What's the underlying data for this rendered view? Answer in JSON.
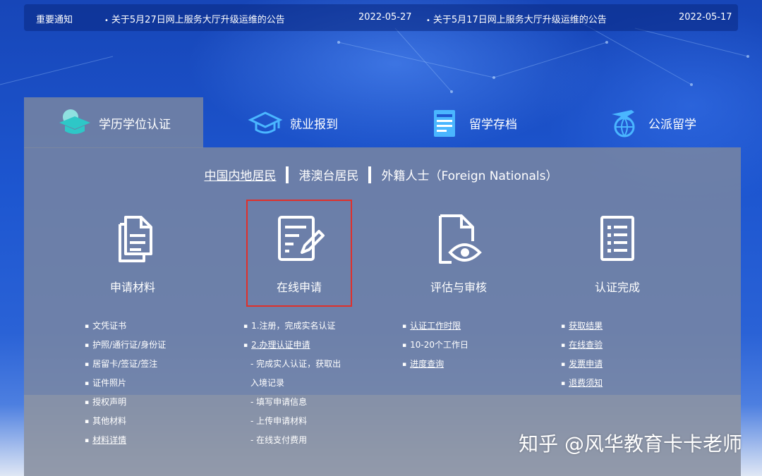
{
  "notice": {
    "label": "重要通知",
    "items": [
      {
        "text": "关于5月27日网上服务大厅升级运维的公告",
        "date": "2022-05-27"
      },
      {
        "text": "关于5月17日网上服务大厅升级运维的公告",
        "date": "2022-05-17"
      }
    ]
  },
  "tabs": [
    {
      "label": "学历学位认证",
      "icon": "graduation-cap-icon"
    },
    {
      "label": "就业报到",
      "icon": "graduation-cap-outline-icon"
    },
    {
      "label": "留学存档",
      "icon": "archive-document-icon"
    },
    {
      "label": "公派留学",
      "icon": "airplane-globe-icon"
    }
  ],
  "residents": [
    "中国内地居民",
    "港澳台居民",
    "外籍人士（Foreign Nationals）"
  ],
  "steps": [
    {
      "label": "申请材料",
      "icon": "documents-icon"
    },
    {
      "label": "在线申请",
      "icon": "form-edit-icon"
    },
    {
      "label": "评估与审核",
      "icon": "document-eye-icon"
    },
    {
      "label": "认证完成",
      "icon": "checklist-icon"
    }
  ],
  "columns": {
    "materials": [
      "文凭证书",
      "护照/通行证/身份证",
      "居留卡/签证/签注",
      "证件照片",
      "授权声明",
      "其他材料",
      "材料详情"
    ],
    "apply": [
      "1.注册，完成实名认证",
      "2.办理认证申请",
      "- 完成实人认证，获取出",
      "入境记录",
      "- 填写申请信息",
      "- 上传申请材料",
      "- 在线支付费用"
    ],
    "review": [
      "认证工作时限",
      "10-20个工作日",
      "进度查询"
    ],
    "done": [
      "获取结果",
      "在线查验",
      "发票申请",
      "退费须知"
    ]
  },
  "watermark": "知乎 @风华教育卡卡老师",
  "colors": {
    "highlight": "#e0302a",
    "background": "#1d56d0"
  }
}
